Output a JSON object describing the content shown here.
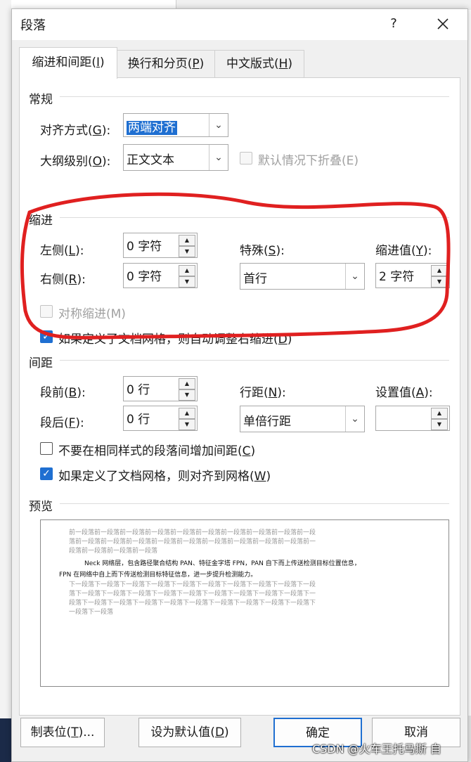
{
  "title": "段落",
  "help": "?",
  "tabs": [
    {
      "label_pre": "缩进和间距(",
      "key": "I",
      "label_post": ")"
    },
    {
      "label_pre": "换行和分页(",
      "key": "P",
      "label_post": ")"
    },
    {
      "label_pre": "中文版式(",
      "key": "H",
      "label_post": ")"
    }
  ],
  "general": {
    "heading": "常规",
    "alignment_label_pre": "对齐方式(",
    "alignment_key": "G",
    "alignment_label_post": "):",
    "alignment_value": "两端对齐",
    "outline_label_pre": "大纲级别(",
    "outline_key": "O",
    "outline_label_post": "):",
    "outline_value": "正文文本",
    "collapse_label": "默认情况下折叠(E)"
  },
  "indent": {
    "heading": "缩进",
    "left_label_pre": "左侧(",
    "left_key": "L",
    "left_label_post": "):",
    "left_value": "0 字符",
    "right_label_pre": "右侧(",
    "right_key": "R",
    "right_label_post": "):",
    "right_value": "0 字符",
    "special_label_pre": "特殊(",
    "special_key": "S",
    "special_label_post": "):",
    "special_value": "首行",
    "by_label_pre": "缩进值(",
    "by_key": "Y",
    "by_label_post": "):",
    "by_value": "2 字符",
    "mirror_label": "对称缩进(M)",
    "auto_adjust_label_pre": "如果定义了文档网格，则自动调整右缩进(",
    "auto_adjust_key": "D",
    "auto_adjust_label_post": ")",
    "auto_adjust_checked": true
  },
  "spacing": {
    "heading": "间距",
    "before_label_pre": "段前(",
    "before_key": "B",
    "before_label_post": "):",
    "before_value": "0 行",
    "after_label_pre": "段后(",
    "after_key": "F",
    "after_label_post": "):",
    "after_value": "0 行",
    "line_label_pre": "行距(",
    "line_key": "N",
    "line_label_post": "):",
    "line_value": "单倍行距",
    "at_label_pre": "设置值(",
    "at_key": "A",
    "at_label_post": "):",
    "at_value": "",
    "no_space_label_pre": "不要在相同样式的段落间增加间距(",
    "no_space_key": "C",
    "no_space_label_post": ")",
    "no_space_checked": false,
    "snap_grid_label_pre": "如果定义了文档网格，则对齐到网格(",
    "snap_grid_key": "W",
    "snap_grid_label_post": ")",
    "snap_grid_checked": true
  },
  "preview": {
    "heading": "预览",
    "prev_lines": [
      "前一段落前一段落前一段落前一段落前一段落前一段落前一段落前一段落前一段落前一段",
      "落前一段落前一段落前一段落前一段落前一段落前一段落前一段落前一段落前一段落前一",
      "段落前一段落前一段落前一段落"
    ],
    "sample_lines": [
      "Neck 网络层，包含路径聚合结构 PAN、特征金字塔 FPN，PAN 自下而上传送检测目标位置信息，",
      "FPN 在网络中自上而下传送检测目标特征信息，进一步提升检测能力。"
    ],
    "next_lines": [
      "下一段落下一段落下一段落下一段落下一段落下一段落下一段落下一段落下一段落下一段",
      "落下一段落下一段落下一段落下一段落下一段落下一段落下一段落下一段落下一段落下一",
      "段落下一段落下一段落下一段落下一段落下一段落下一段落下一段落下一段落下一段落下",
      "一段落下一段落"
    ]
  },
  "buttons": {
    "tabs_pre": "制表位(",
    "tabs_key": "T",
    "tabs_post": ")...",
    "default_pre": "设为默认值(",
    "default_key": "D",
    "default_post": ")",
    "ok": "确定",
    "cancel": "取消"
  },
  "watermark": "CSDN @火车王托马斯 自",
  "colors": {
    "accent": "#1f6fd1",
    "highlight_oval": "#e02020"
  }
}
